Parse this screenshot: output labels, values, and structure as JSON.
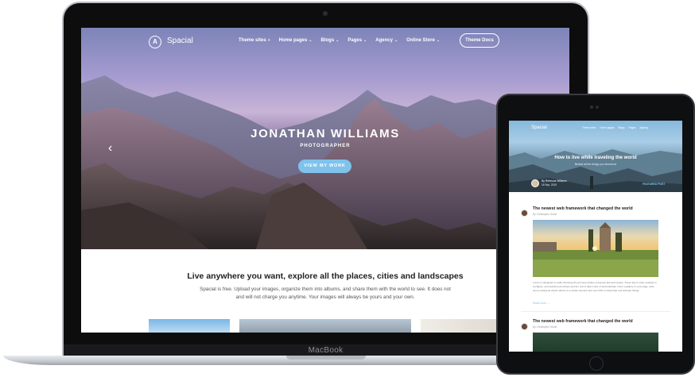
{
  "laptop": {
    "brand": "MacBook",
    "site": {
      "logo_text": "Spacial",
      "logo_glyph": "A",
      "nav": [
        {
          "label": "Theme sites",
          "caret": "+"
        },
        {
          "label": "Home pages",
          "caret": "⌄"
        },
        {
          "label": "Blogs",
          "caret": "⌄"
        },
        {
          "label": "Pages",
          "caret": "⌄"
        },
        {
          "label": "Agency",
          "caret": "⌄"
        },
        {
          "label": "Online Store",
          "caret": "⌄"
        }
      ],
      "docs_button": "Theme Docs",
      "hero": {
        "title": "JONATHAN WILLIAMS",
        "subtitle": "PHOTOGRAPHER",
        "cta": "VIEW MY WORK",
        "prev_arrow": "‹"
      },
      "section": {
        "title": "Live anywhere you want, explore all the places, cities and landscapes",
        "text": "Spacial is free. Upload your images, organize them into albums, and share them with the world to see. It does not and will not charge you anytime. Your images will always be yours and your own."
      }
    }
  },
  "tablet": {
    "site": {
      "logo_text": "Spacial",
      "nav": [
        "Theme sites",
        "Home pages",
        "Blogs",
        "Pages",
        "Agency"
      ],
      "hero": {
        "title": "How to live while traveling the world",
        "subtitle": "Behind all the things you should do",
        "author": "By Rebecca Williams",
        "date": "16 Sep, 2019",
        "tag": "FEATURED POST"
      },
      "posts": [
        {
          "title": "The newest web framework that changed the world",
          "author": "By Christopher Stone",
          "excerpt": "Lorem is designed to make throwing off your best photos extremely fast and simple. These aren't many settings to configure, and upload your photos and the rest is taken care of automatically. Insert a gallery in your page, write some solving as shown above to a simple element and use CSS to show hide and animate things.",
          "read_more": "Read more →"
        },
        {
          "title": "The newest web framework that changed the world",
          "author": "By Christopher Stone"
        }
      ]
    }
  },
  "colors": {
    "accent": "#7fc3ec",
    "device_dark": "#0d0d0e",
    "heading": "#222222"
  }
}
